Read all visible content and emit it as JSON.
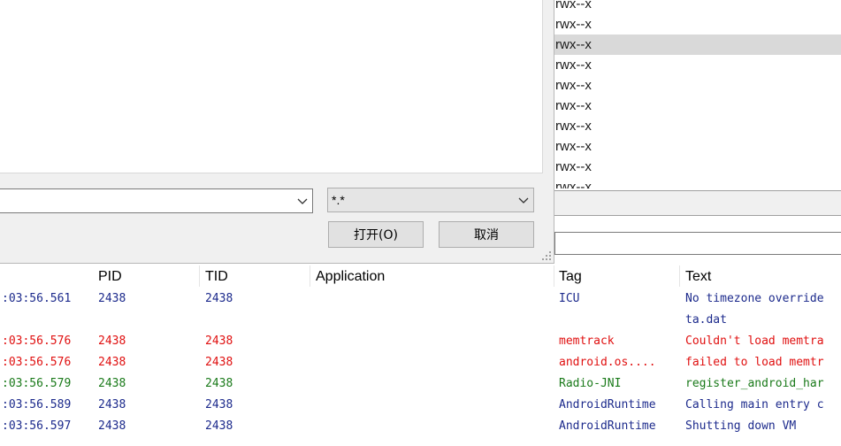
{
  "perm_list": {
    "items": [
      "rwx--x",
      "rwx--x",
      "rwx--x",
      "rwx--x",
      "rwx--x",
      "rwx--x",
      "rwx--x",
      "rwx--x",
      "rwx--x",
      "rwx--x"
    ],
    "selected_index": 2
  },
  "dialog": {
    "filename_value": "",
    "filter_value": "*.*",
    "open_label": "打开(O)",
    "cancel_label": "取消"
  },
  "log": {
    "columns": [
      "PID",
      "TID",
      "Application",
      "Tag",
      "Text"
    ],
    "rows": [
      {
        "time": ":03:56.561",
        "pid": "2438",
        "tid": "2438",
        "app": "",
        "tag": "ICU",
        "text": "No timezone override",
        "level": "debug"
      },
      {
        "time": "",
        "pid": "",
        "tid": "",
        "app": "",
        "tag": "",
        "text": "ta.dat",
        "level": "debug"
      },
      {
        "time": ":03:56.576",
        "pid": "2438",
        "tid": "2438",
        "app": "",
        "tag": "memtrack",
        "text": "Couldn't load memtra",
        "level": "error"
      },
      {
        "time": ":03:56.576",
        "pid": "2438",
        "tid": "2438",
        "app": "",
        "tag": "android.os....",
        "text": "failed to load memtr",
        "level": "error"
      },
      {
        "time": ":03:56.579",
        "pid": "2438",
        "tid": "2438",
        "app": "",
        "tag": "Radio-JNI",
        "text": "register_android_har",
        "level": "info"
      },
      {
        "time": ":03:56.589",
        "pid": "2438",
        "tid": "2438",
        "app": "",
        "tag": "AndroidRuntime",
        "text": "Calling main entry c",
        "level": "debug"
      },
      {
        "time": ":03:56.597",
        "pid": "2438",
        "tid": "2438",
        "app": "",
        "tag": "AndroidRuntime",
        "text": "Shutting down VM",
        "level": "debug"
      }
    ]
  },
  "colors": {
    "debug": "#1c2a8c",
    "error": "#e01010",
    "info": "#1a7a1a"
  }
}
